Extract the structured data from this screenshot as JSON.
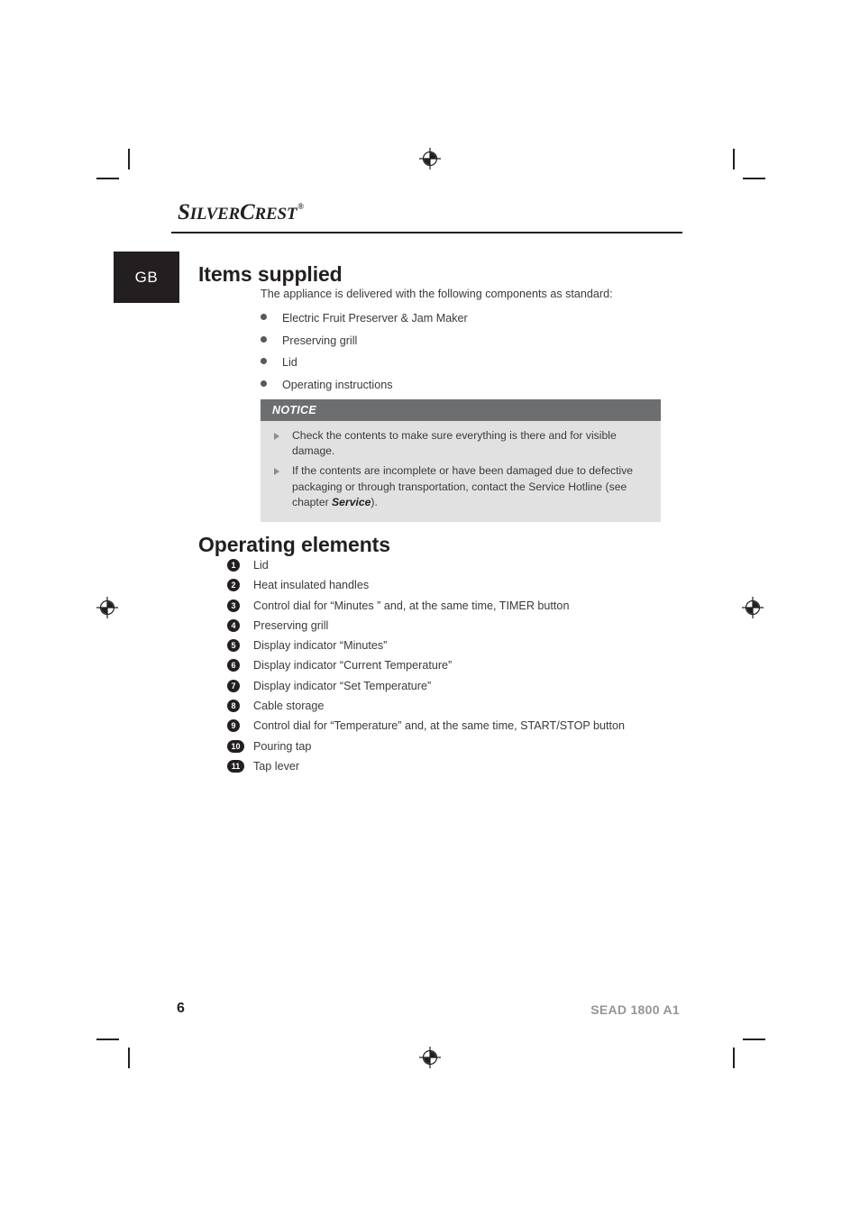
{
  "brand": {
    "logo_part1": "S",
    "logo_part2": "ILVER",
    "logo_part3": "C",
    "logo_part4": "REST",
    "logo_registered": "®"
  },
  "language_tab": {
    "label": "GB"
  },
  "sections": {
    "items_supplied": {
      "heading": "Items supplied",
      "intro": "The appliance is delivered with the following components as standard:",
      "bullets": [
        "Electric Fruit Preserver & Jam Maker",
        "Preserving grill",
        "Lid",
        "Operating instructions"
      ]
    },
    "notice": {
      "title": "NOTICE",
      "rows": [
        {
          "before": "Check the contents to make sure everything is there and for visible damage.",
          "bold": "",
          "after": ""
        },
        {
          "before": "If the contents are incomplete or have been damaged due to defective packaging or through transportation, contact the Service Hotline (see chapter ",
          "bold": "Service",
          "after": ")."
        }
      ]
    },
    "operating_elements": {
      "heading": "Operating elements",
      "items": [
        {
          "number": "1",
          "label": "Lid"
        },
        {
          "number": "2",
          "label": "Heat insulated handles"
        },
        {
          "number": "3",
          "label": "Control dial for “Minutes ” and, at the same time, TIMER button"
        },
        {
          "number": "4",
          "label": "Preserving grill"
        },
        {
          "number": "5",
          "label": "Display indicator “Minutes”"
        },
        {
          "number": "6",
          "label": "Display indicator “Current Temperature”"
        },
        {
          "number": "7",
          "label": "Display indicator “Set Temperature”"
        },
        {
          "number": "8",
          "label": "Cable storage"
        },
        {
          "number": "9",
          "label": "Control dial for “Temperature” and, at the same time, START/STOP button"
        },
        {
          "number": "10",
          "label": "Pouring tap"
        },
        {
          "number": "11",
          "label": "Tap lever"
        }
      ]
    }
  },
  "footer": {
    "page_number": "6",
    "model": "SEAD 1800 A1"
  },
  "colors": {
    "ink": "#231f20",
    "notice_header_bg": "#6d6e70",
    "notice_body_bg": "#e1e1e1",
    "model_gray": "#939598"
  }
}
